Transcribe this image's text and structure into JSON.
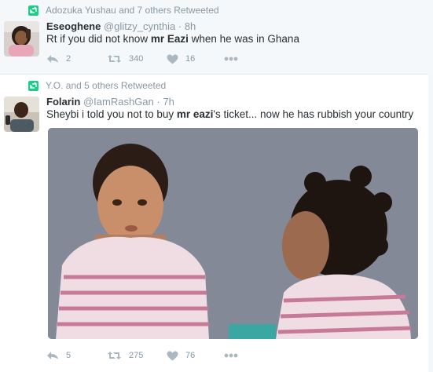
{
  "tweets": [
    {
      "retweet_context": "Adozuka Yushau and 7 others Retweeted",
      "name": "Eseoghene",
      "handle": "@glitzy_cynthia",
      "separator": "·",
      "time": "8h",
      "text_before": "Rt if you did not know ",
      "text_bold": "mr Eazi",
      "text_after": " when he was in Ghana",
      "reply_count": "2",
      "retweet_count": "340",
      "like_count": "16"
    },
    {
      "retweet_context": "Y.O. and 5 others Retweeted",
      "name": "Folarin",
      "handle": "@IamRashGan",
      "separator": "·",
      "time": "7h",
      "text_before": "Sheybi  i told you not to buy ",
      "text_bold": "mr eazi",
      "text_after": "'s ticket... now he has rubbish your country",
      "reply_count": "5",
      "retweet_count": "275",
      "like_count": "76"
    }
  ],
  "colors": {
    "retweet_badge": "#19cf86",
    "muted_text": "#8899a6",
    "primary_text": "#292f33",
    "icon": "#aab8c2"
  },
  "icons": {
    "retweet_context": "retweet-badge-icon",
    "reply": "reply-icon",
    "retweet": "retweet-icon",
    "like": "heart-icon",
    "more": "more-icon"
  }
}
